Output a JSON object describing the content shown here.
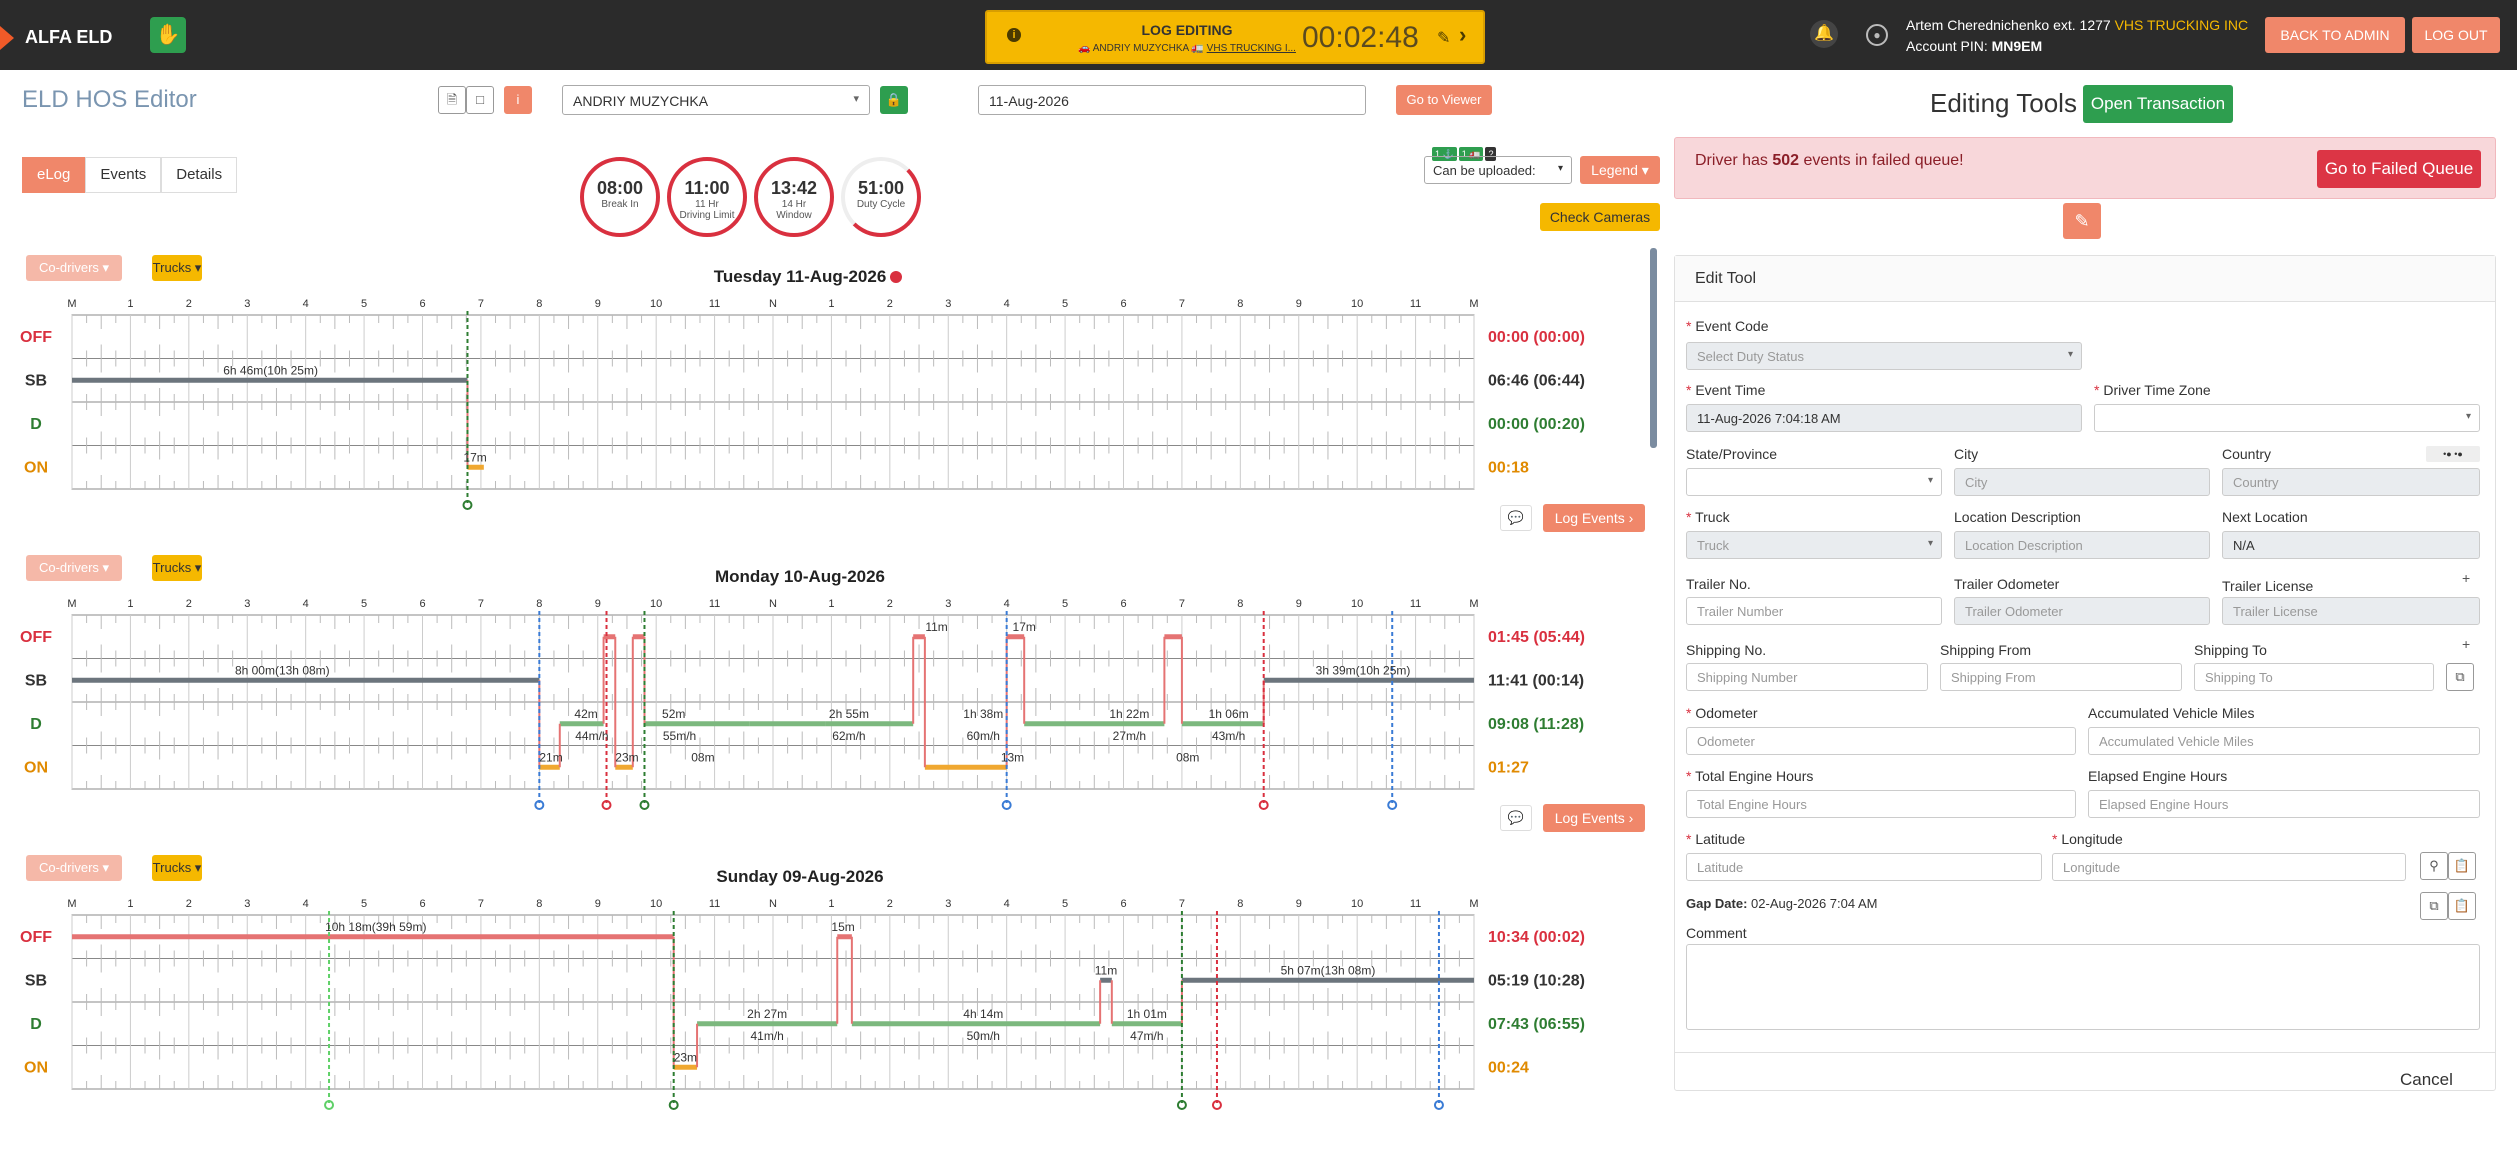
{
  "topbar": {
    "app_name": "ALFA ELD",
    "log_editing_title": "LOG EDITING",
    "log_editing_sub_prefix": "🚗 ANDRIY MUZYCHKA 🚛 ",
    "log_editing_sub_company": "VHS TRUCKING I...",
    "timer": "00:02:48",
    "user_name": "Artem Cherednichenko ext. 1277",
    "user_company": "VHS TRUCKING INC",
    "account_pin_label": "Account PIN:",
    "account_pin": "MN9EM",
    "back_to_admin": "BACK TO ADMIN",
    "logout": "LOG OUT"
  },
  "header": {
    "page_title": "ELD HOS Editor",
    "driver": "ANDRIY MUZYCHKA",
    "date": "11-Aug-2026",
    "goto_viewer": "Go to Viewer"
  },
  "tabs": [
    "eLog",
    "Events",
    "Details"
  ],
  "clocks": [
    {
      "time": "08:00",
      "label1": "Break In",
      "label2": ""
    },
    {
      "time": "11:00",
      "label1": "11 Hr",
      "label2": "Driving Limit"
    },
    {
      "time": "13:42",
      "label1": "14 Hr",
      "label2": "Window"
    },
    {
      "time": "51:00",
      "label1": "Duty Cycle",
      "label2": ""
    }
  ],
  "controls": {
    "badge1": "1 ⚓",
    "badge2": "1 🚛",
    "badge3": "?",
    "upload_select": "Can be uploaded:",
    "legend": "Legend",
    "check_cameras": "Check Cameras",
    "co_drivers": "Co-drivers",
    "trucks": "Trucks",
    "log_events": "Log Events"
  },
  "hour_labels": [
    "M",
    "1",
    "2",
    "3",
    "4",
    "5",
    "6",
    "7",
    "8",
    "9",
    "10",
    "11",
    "N",
    "1",
    "2",
    "3",
    "4",
    "5",
    "6",
    "7",
    "8",
    "9",
    "10",
    "11",
    "M"
  ],
  "row_labels": [
    "OFF",
    "SB",
    "D",
    "ON"
  ],
  "days": [
    {
      "title": "Tuesday 11-Aug-2026",
      "totals": [
        "00:00 (00:00)",
        "06:46 (06:44)",
        "00:00 (00:20)",
        "00:18"
      ],
      "labels": [
        "6h 46m(10h 25m)",
        "17m"
      ]
    },
    {
      "title": "Monday 10-Aug-2026",
      "totals": [
        "01:45 (05:44)",
        "11:41 (00:14)",
        "09:08 (11:28)",
        "01:27"
      ],
      "labels": [
        "8h 00m(13h 08m)",
        "3h 39m(10h 25m)",
        "2h 55m",
        "1h 38m",
        "1h 22m",
        "1h 06m",
        "62m/h",
        "60m/h",
        "27m/h",
        "43m/h",
        "21m",
        "13m",
        "08m",
        "11m",
        "17m",
        "42m",
        "52m",
        "55m/h",
        "44m/h",
        "23m",
        "08m"
      ]
    },
    {
      "title": "Sunday 09-Aug-2026",
      "totals": [
        "10:34 (00:02)",
        "05:19 (10:28)",
        "07:43 (06:55)",
        "00:24"
      ],
      "labels": [
        "10h 18m(39h 59m)",
        "15m",
        "5h 07m(13h 08m)",
        "11m",
        "2h 27m",
        "4h 14m",
        "1h 01m",
        "41m/h",
        "50m/h",
        "47m/h",
        "23m"
      ]
    }
  ],
  "editor": {
    "title": "Editing Tools",
    "open_transaction": "Open Transaction",
    "alert_prefix": "Driver has ",
    "alert_count": "502",
    "alert_suffix": " events in failed queue!",
    "goto_failed": "Go to Failed Queue",
    "edit_tool_header": "Edit Tool",
    "event_code_label": "Event Code",
    "event_code_ph": "Select Duty Status",
    "event_time_label": "Event Time",
    "event_time_value": "11-Aug-2026 7:04:18 AM",
    "driver_tz_label": "Driver Time Zone",
    "state_label": "State/Province",
    "city_label": "City",
    "city_ph": "City",
    "country_label": "Country",
    "country_ph": "Country",
    "truck_label": "Truck",
    "truck_ph": "Truck",
    "loc_desc_label": "Location Description",
    "loc_desc_ph": "Location Description",
    "next_loc_label": "Next Location",
    "next_loc_value": "N/A",
    "trailer_no_label": "Trailer No.",
    "trailer_no_ph": "Trailer Number",
    "trailer_odo_label": "Trailer Odometer",
    "trailer_odo_ph": "Trailer Odometer",
    "trailer_lic_label": "Trailer License",
    "trailer_lic_ph": "Trailer License",
    "ship_no_label": "Shipping No.",
    "ship_no_ph": "Shipping Number",
    "ship_from_label": "Shipping From",
    "ship_from_ph": "Shipping From",
    "ship_to_label": "Shipping To",
    "ship_to_ph": "Shipping To",
    "odometer_label": "Odometer",
    "odometer_ph": "Odometer",
    "acc_miles_label": "Accumulated Vehicle Miles",
    "acc_miles_ph": "Accumulated Vehicle Miles",
    "engine_hours_label": "Total Engine Hours",
    "engine_hours_ph": "Total Engine Hours",
    "elapsed_hours_label": "Elapsed Engine Hours",
    "elapsed_hours_ph": "Elapsed Engine Hours",
    "lat_label": "Latitude",
    "lat_ph": "Latitude",
    "lon_label": "Longitude",
    "lon_ph": "Longitude",
    "gap_label": "Gap Date:",
    "gap_value": "02-Aug-2026 7:04 AM",
    "comment_label": "Comment",
    "cancel": "Cancel"
  },
  "colors": {
    "off": "#d9303f",
    "sb": "#333333",
    "d": "#2e7d32",
    "on": "#e08a00",
    "accent": "#f0876a"
  }
}
